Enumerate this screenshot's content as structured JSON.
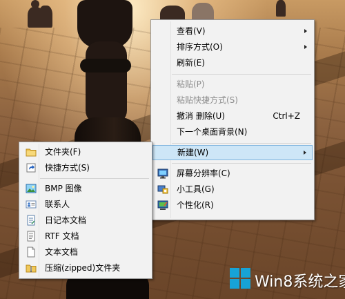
{
  "main_menu": {
    "items": [
      {
        "label": "查看(V)",
        "submenu": true
      },
      {
        "label": "排序方式(O)",
        "submenu": true
      },
      {
        "label": "刷新(E)"
      },
      {
        "label": "粘贴(P)",
        "disabled": true
      },
      {
        "label": "粘贴快捷方式(S)",
        "disabled": true
      },
      {
        "label": "撤消 删除(U)",
        "shortcut": "Ctrl+Z"
      },
      {
        "label": "下一个桌面背景(N)"
      },
      {
        "label": "新建(W)",
        "submenu": true,
        "highlighted": true
      },
      {
        "label": "屏幕分辨率(C)",
        "icon": "monitor-icon"
      },
      {
        "label": "小工具(G)",
        "icon": "gadgets-icon"
      },
      {
        "label": "个性化(R)",
        "icon": "personalize-icon"
      }
    ]
  },
  "new_submenu": {
    "items": [
      {
        "label": "文件夹(F)",
        "icon": "folder-icon"
      },
      {
        "label": "快捷方式(S)",
        "icon": "shortcut-icon"
      },
      {
        "label": "BMP 图像",
        "icon": "bmp-image-icon"
      },
      {
        "label": "联系人",
        "icon": "contact-icon"
      },
      {
        "label": "日记本文档",
        "icon": "journal-document-icon"
      },
      {
        "label": "RTF 文档",
        "icon": "rtf-document-icon"
      },
      {
        "label": "文本文档",
        "icon": "text-document-icon"
      },
      {
        "label": "压缩(zipped)文件夹",
        "icon": "zip-folder-icon"
      }
    ]
  },
  "watermark": {
    "text": "Win8系统之家"
  },
  "colors": {
    "highlight": "#cde6f7",
    "highlight_border": "#7fb4de",
    "menu_bg": "#f2f2f2",
    "disabled_text": "#8e8e8e",
    "win8_blue": "#17a3d6"
  }
}
